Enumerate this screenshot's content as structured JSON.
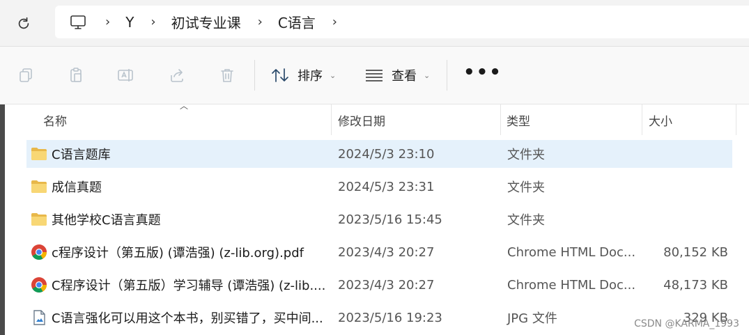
{
  "breadcrumb": {
    "items": [
      "Y",
      "初试专业课",
      "C语言"
    ]
  },
  "toolbar": {
    "sort_label": "排序",
    "view_label": "查看",
    "more_label": "•••"
  },
  "columns": {
    "name": "名称",
    "date": "修改日期",
    "type": "类型",
    "size": "大小"
  },
  "files": [
    {
      "name": "C语言题库",
      "date": "2024/5/3 23:10",
      "type": "文件夹",
      "size": "",
      "icon": "folder-icon"
    },
    {
      "name": "成信真题",
      "date": "2024/5/3 23:31",
      "type": "文件夹",
      "size": "",
      "icon": "folder-icon"
    },
    {
      "name": "其他学校C语言真题",
      "date": "2023/5/16 15:45",
      "type": "文件夹",
      "size": "",
      "icon": "folder-icon"
    },
    {
      "name": "c程序设计（第五版) (谭浩强) (z-lib.org).pdf",
      "date": "2023/4/3 20:27",
      "type": "Chrome HTML Doc...",
      "size": "80,152 KB",
      "icon": "chrome-icon"
    },
    {
      "name": "C程序设计（第五版）学习辅导 (谭浩强) (z-lib....",
      "date": "2023/4/3 20:27",
      "type": "Chrome HTML Doc...",
      "size": "48,173 KB",
      "icon": "chrome-icon"
    },
    {
      "name": "C语言强化可以用这个本书，别买错了，买中间...",
      "date": "2023/5/16 19:23",
      "type": "JPG 文件",
      "size": "329 KB",
      "icon": "image-file-icon"
    }
  ],
  "colors": {
    "selected_row": "#e5f1fb",
    "folder": "#f8d775"
  },
  "watermark": "CSDN @KARMA_1993"
}
